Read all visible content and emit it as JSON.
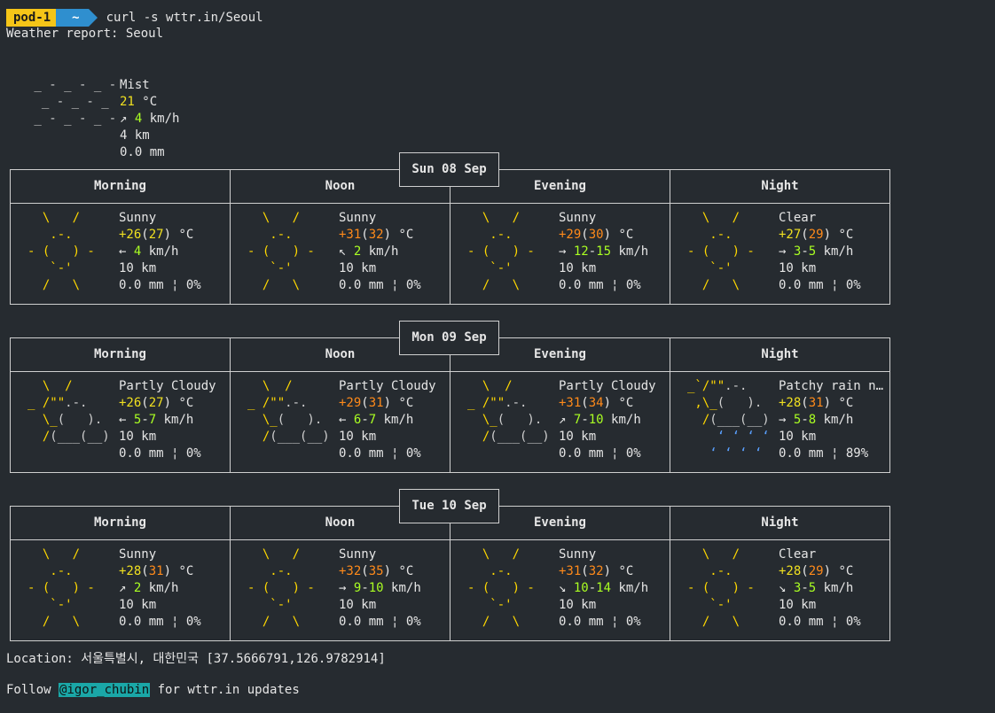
{
  "prompt": {
    "host": "pod-1",
    "dir": "~",
    "command": "curl -s wttr.in/Seoul"
  },
  "report_title": "Weather report: Seoul",
  "current": {
    "condition": "Mist",
    "temp": "21",
    "temp_unit": "°C",
    "wind_dir": "↗",
    "wind": "4",
    "wind_unit": "km/h",
    "visibility": "4 km",
    "precip": "0.0 mm",
    "art": " _ - _ - _ -\n  _ - _ - _\n _ - _ - _ -"
  },
  "periods": [
    "Morning",
    "Noon",
    "Evening",
    "Night"
  ],
  "days": [
    {
      "date": "Sun 08 Sep",
      "cells": [
        {
          "cond": "Sunny",
          "t1": "+26",
          "t2": "27",
          "unit": "°C",
          "wdir": "←",
          "w1": "4",
          "w2": "",
          "vis": "10 km",
          "precip": "0.0 mm ¦ 0%"
        },
        {
          "cond": "Sunny",
          "t1": "+31",
          "t2": "32",
          "unit": "°C",
          "wdir": "↖",
          "w1": "2",
          "w2": "",
          "vis": "10 km",
          "precip": "0.0 mm ¦ 0%"
        },
        {
          "cond": "Sunny",
          "t1": "+29",
          "t2": "30",
          "unit": "°C",
          "wdir": "→",
          "w1": "12",
          "w2": "15",
          "vis": "10 km",
          "precip": "0.0 mm ¦ 0%"
        },
        {
          "cond": "Clear",
          "t1": "+27",
          "t2": "29",
          "unit": "°C",
          "wdir": "→",
          "w1": "3",
          "w2": "5",
          "vis": "10 km",
          "precip": "0.0 mm ¦ 0%"
        }
      ]
    },
    {
      "date": "Mon 09 Sep",
      "cells": [
        {
          "cond": "Partly Cloudy",
          "t1": "+26",
          "t2": "27",
          "unit": "°C",
          "wdir": "←",
          "w1": "5",
          "w2": "7",
          "vis": "10 km",
          "precip": "0.0 mm ¦ 0%"
        },
        {
          "cond": "Partly Cloudy",
          "t1": "+29",
          "t2": "31",
          "unit": "°C",
          "wdir": "←",
          "w1": "6",
          "w2": "7",
          "vis": "10 km",
          "precip": "0.0 mm ¦ 0%"
        },
        {
          "cond": "Partly Cloudy",
          "t1": "+31",
          "t2": "34",
          "unit": "°C",
          "wdir": "↗",
          "w1": "7",
          "w2": "10",
          "vis": "10 km",
          "precip": "0.0 mm ¦ 0%"
        },
        {
          "cond": "Patchy rain ne…",
          "t1": "+28",
          "t2": "31",
          "unit": "°C",
          "wdir": "→",
          "w1": "5",
          "w2": "8",
          "vis": "10 km",
          "precip": "0.0 mm ¦ 89%"
        }
      ]
    },
    {
      "date": "Tue 10 Sep",
      "cells": [
        {
          "cond": "Sunny",
          "t1": "+28",
          "t2": "31",
          "unit": "°C",
          "wdir": "↗",
          "w1": "2",
          "w2": "",
          "vis": "10 km",
          "precip": "0.0 mm ¦ 0%"
        },
        {
          "cond": "Sunny",
          "t1": "+32",
          "t2": "35",
          "unit": "°C",
          "wdir": "→",
          "w1": "9",
          "w2": "10",
          "vis": "10 km",
          "precip": "0.0 mm ¦ 0%"
        },
        {
          "cond": "Sunny",
          "t1": "+31",
          "t2": "32",
          "unit": "°C",
          "wdir": "↘",
          "w1": "10",
          "w2": "14",
          "vis": "10 km",
          "precip": "0.0 mm ¦ 0%"
        },
        {
          "cond": "Clear",
          "t1": "+28",
          "t2": "29",
          "unit": "°C",
          "wdir": "↘",
          "w1": "3",
          "w2": "5",
          "vis": "10 km",
          "precip": "0.0 mm ¦ 0%"
        }
      ]
    }
  ],
  "location": "Location: 서울특별시, 대한민국 [37.5666791,126.9782914]",
  "follow": {
    "prefix": "Follow ",
    "handle": "@igor_chubin",
    "suffix": " for wttr.in updates"
  },
  "colors": {
    "background": "#262b30",
    "sun": "#ffd800",
    "temp_warm": "#ff8a1a",
    "temp_mild": "#f0e020",
    "wind": "#aaff22",
    "rain": "#5aa0ff"
  }
}
